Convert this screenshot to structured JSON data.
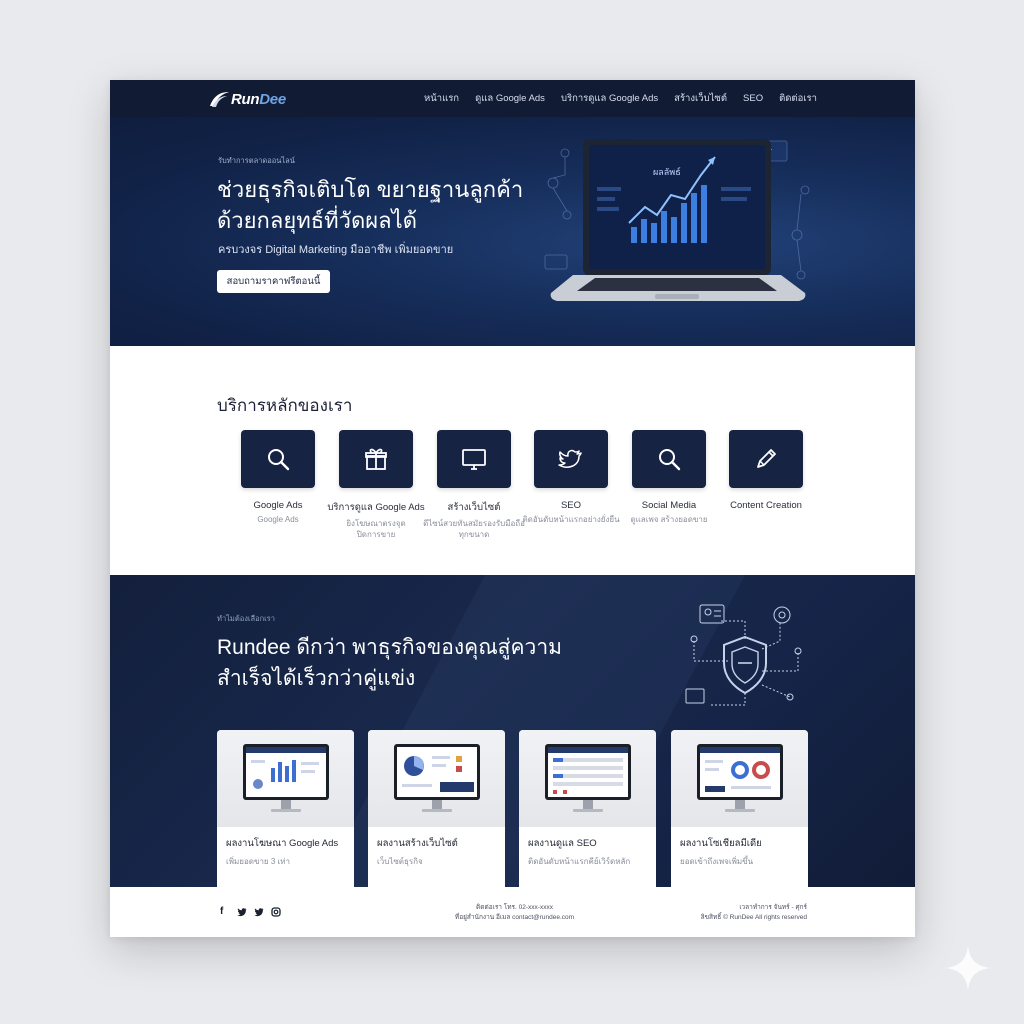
{
  "nav": {
    "brand_prefix": "Run",
    "brand_suffix": "Dee",
    "links": [
      "หน้าแรก",
      "ดูแล Google Ads",
      "บริการดูแล Google Ads",
      "สร้างเว็บไซต์",
      "SEO",
      "ติดต่อเรา"
    ]
  },
  "hero": {
    "eyebrow": "รับทำการตลาดออนไลน์",
    "title_line1": "ช่วยธุรกิจเติบโต ขยายฐานลูกค้า",
    "title_line2": "ด้วยกลยุทธ์ที่วัดผลได้",
    "subtitle": "ครบวงจร Digital Marketing มืออาชีพ เพิ่มยอดขาย",
    "cta": "สอบถามราคาฟรีตอนนี้",
    "screen_text": "ผลลัพธ์"
  },
  "services": {
    "title": "บริการหลักของเรา",
    "items": [
      {
        "name": "Google Ads",
        "desc": [
          "Google Ads"
        ],
        "icon": "search-icon"
      },
      {
        "name": "บริการดูแล Google Ads",
        "desc": [
          "ยิงโฆษณาตรงจุด",
          "ปิดการขาย"
        ],
        "icon": "gift-icon"
      },
      {
        "name": "สร้างเว็บไซต์",
        "desc": [
          "ดีไซน์สวยทันสมัยรองรับมือถือ",
          "ทุกขนาด"
        ],
        "icon": "monitor-icon"
      },
      {
        "name": "SEO",
        "desc": [
          "ติดอันดับหน้าแรกอย่างยั่งยืน"
        ],
        "icon": "twitter-icon"
      },
      {
        "name": "Social Media",
        "desc": [
          "ดูแลเพจ สร้างยอดขาย"
        ],
        "icon": "search-icon"
      },
      {
        "name": "Content Creation",
        "desc": [],
        "icon": "pen-icon"
      }
    ]
  },
  "why": {
    "eyebrow": "ทำไมต้องเลือกเรา",
    "title_line1": "Rundee ดีกว่า พาธุรกิจของคุณสู่ความ",
    "title_line2": "สำเร็จได้เร็วกว่าคู่แข่ง",
    "cases": [
      {
        "title": "ผลงานโฆษณา Google Ads",
        "sub": "เพิ่มยอดขาย 3 เท่า"
      },
      {
        "title": "ผลงานสร้างเว็บไซต์",
        "sub": "เว็บไซต์ธุรกิจ"
      },
      {
        "title": "ผลงานดูแล SEO",
        "sub": "ติดอันดับหน้าแรกคีย์เวิร์ดหลัก"
      },
      {
        "title": "ผลงานโซเชียลมีเดีย",
        "sub": "ยอดเข้าถึงเพจเพิ่มขึ้น"
      }
    ]
  },
  "footer": {
    "social": [
      "facebook-icon",
      "twitter-icon",
      "twitter-icon",
      "instagram-icon"
    ],
    "mid_line1": "ติดต่อเรา โทร. 02-xxx-xxxx",
    "mid_line2": "ที่อยู่สำนักงาน อีเมล contact@rundee.com",
    "right_line1": "เวลาทำการ จันทร์ - ศุกร์",
    "right_line2": "ลิขสิทธิ์ © RunDee All rights reserved"
  },
  "colors": {
    "navy": "#111b33",
    "hero": "#17305e",
    "accent_blue": "#3c7fe0",
    "card_navy": "#172342"
  }
}
